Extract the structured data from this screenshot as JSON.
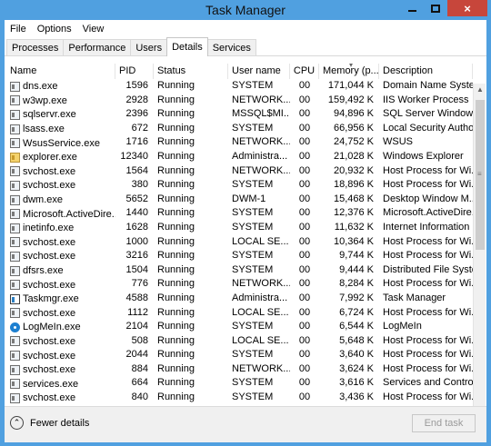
{
  "window": {
    "title": "Task Manager",
    "controls": {
      "minimize": "minimize-icon",
      "maximize": "maximize-icon",
      "close": "×"
    }
  },
  "menu": [
    "File",
    "Options",
    "View"
  ],
  "tabs": [
    "Processes",
    "Performance",
    "Users",
    "Details",
    "Services"
  ],
  "active_tab": "Details",
  "columns": [
    "Name",
    "PID",
    "Status",
    "User name",
    "CPU",
    "Memory (p...",
    "Description"
  ],
  "rows": [
    {
      "name": "dns.exe",
      "pid": "1596",
      "status": "Running",
      "user": "SYSTEM",
      "cpu": "00",
      "mem": "171,044 K",
      "desc": "Domain Name Syste...",
      "icon": "service"
    },
    {
      "name": "w3wp.exe",
      "pid": "2928",
      "status": "Running",
      "user": "NETWORK...",
      "cpu": "00",
      "mem": "159,492 K",
      "desc": "IIS Worker Process",
      "icon": "service"
    },
    {
      "name": "sqlservr.exe",
      "pid": "2396",
      "status": "Running",
      "user": "MSSQL$MI...",
      "cpu": "00",
      "mem": "94,896 K",
      "desc": "SQL Server Windows...",
      "icon": "service"
    },
    {
      "name": "lsass.exe",
      "pid": "672",
      "status": "Running",
      "user": "SYSTEM",
      "cpu": "00",
      "mem": "66,956 K",
      "desc": "Local Security Autho...",
      "icon": "service"
    },
    {
      "name": "WsusService.exe",
      "pid": "1716",
      "status": "Running",
      "user": "NETWORK...",
      "cpu": "00",
      "mem": "24,752 K",
      "desc": "WSUS",
      "icon": "service"
    },
    {
      "name": "explorer.exe",
      "pid": "12340",
      "status": "Running",
      "user": "Administra...",
      "cpu": "00",
      "mem": "21,028 K",
      "desc": "Windows Explorer",
      "icon": "explorer"
    },
    {
      "name": "svchost.exe",
      "pid": "1564",
      "status": "Running",
      "user": "NETWORK...",
      "cpu": "00",
      "mem": "20,932 K",
      "desc": "Host Process for Wi...",
      "icon": "service"
    },
    {
      "name": "svchost.exe",
      "pid": "380",
      "status": "Running",
      "user": "SYSTEM",
      "cpu": "00",
      "mem": "18,896 K",
      "desc": "Host Process for Wi...",
      "icon": "service"
    },
    {
      "name": "dwm.exe",
      "pid": "5652",
      "status": "Running",
      "user": "DWM-1",
      "cpu": "00",
      "mem": "15,468 K",
      "desc": "Desktop Window M...",
      "icon": "service"
    },
    {
      "name": "Microsoft.ActiveDire...",
      "pid": "1440",
      "status": "Running",
      "user": "SYSTEM",
      "cpu": "00",
      "mem": "12,376 K",
      "desc": "Microsoft.ActiveDire...",
      "icon": "service"
    },
    {
      "name": "inetinfo.exe",
      "pid": "1628",
      "status": "Running",
      "user": "SYSTEM",
      "cpu": "00",
      "mem": "11,632 K",
      "desc": "Internet Information ...",
      "icon": "service"
    },
    {
      "name": "svchost.exe",
      "pid": "1000",
      "status": "Running",
      "user": "LOCAL SE...",
      "cpu": "00",
      "mem": "10,364 K",
      "desc": "Host Process for Wi...",
      "icon": "service"
    },
    {
      "name": "svchost.exe",
      "pid": "3216",
      "status": "Running",
      "user": "SYSTEM",
      "cpu": "00",
      "mem": "9,744 K",
      "desc": "Host Process for Wi...",
      "icon": "service"
    },
    {
      "name": "dfsrs.exe",
      "pid": "1504",
      "status": "Running",
      "user": "SYSTEM",
      "cpu": "00",
      "mem": "9,444 K",
      "desc": "Distributed File Syste...",
      "icon": "service"
    },
    {
      "name": "svchost.exe",
      "pid": "776",
      "status": "Running",
      "user": "NETWORK...",
      "cpu": "00",
      "mem": "8,284 K",
      "desc": "Host Process for Wi...",
      "icon": "service"
    },
    {
      "name": "Taskmgr.exe",
      "pid": "4588",
      "status": "Running",
      "user": "Administra...",
      "cpu": "00",
      "mem": "7,992 K",
      "desc": "Task Manager",
      "icon": "taskmgr"
    },
    {
      "name": "svchost.exe",
      "pid": "1112",
      "status": "Running",
      "user": "LOCAL SE...",
      "cpu": "00",
      "mem": "6,724 K",
      "desc": "Host Process for Wi...",
      "icon": "service"
    },
    {
      "name": "LogMeIn.exe",
      "pid": "2104",
      "status": "Running",
      "user": "SYSTEM",
      "cpu": "00",
      "mem": "6,544 K",
      "desc": "LogMeIn",
      "icon": "logmein"
    },
    {
      "name": "svchost.exe",
      "pid": "508",
      "status": "Running",
      "user": "LOCAL SE...",
      "cpu": "00",
      "mem": "5,648 K",
      "desc": "Host Process for Wi...",
      "icon": "service"
    },
    {
      "name": "svchost.exe",
      "pid": "2044",
      "status": "Running",
      "user": "SYSTEM",
      "cpu": "00",
      "mem": "3,640 K",
      "desc": "Host Process for Wi...",
      "icon": "service"
    },
    {
      "name": "svchost.exe",
      "pid": "884",
      "status": "Running",
      "user": "NETWORK...",
      "cpu": "00",
      "mem": "3,624 K",
      "desc": "Host Process for Wi...",
      "icon": "service"
    },
    {
      "name": "services.exe",
      "pid": "664",
      "status": "Running",
      "user": "SYSTEM",
      "cpu": "00",
      "mem": "3,616 K",
      "desc": "Services and Control...",
      "icon": "service"
    },
    {
      "name": "svchost.exe",
      "pid": "840",
      "status": "Running",
      "user": "SYSTEM",
      "cpu": "00",
      "mem": "3,436 K",
      "desc": "Host Process for Wi...",
      "icon": "service"
    }
  ],
  "footer": {
    "fewer_details": "Fewer details",
    "end_task": "End task"
  },
  "colors": {
    "titlebar": "#50a0e0",
    "close": "#c7463b"
  }
}
